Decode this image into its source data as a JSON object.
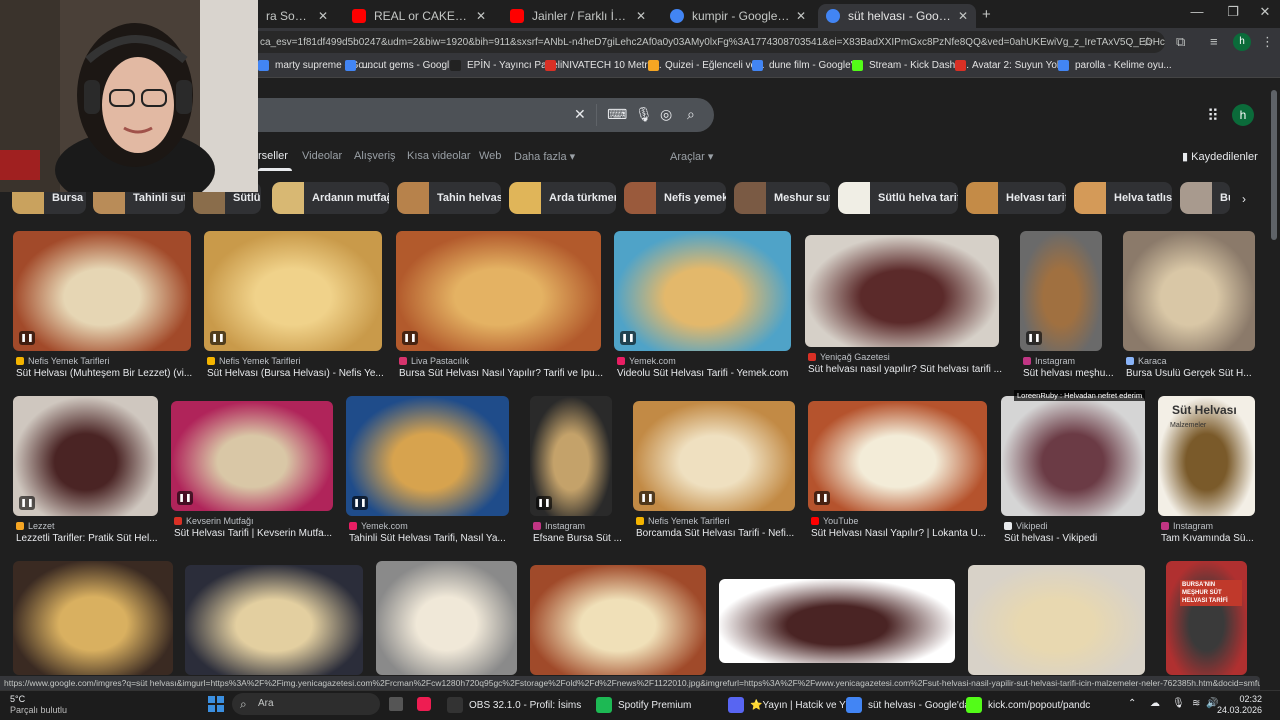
{
  "browser": {
    "tabs": [
      {
        "title": "ra Sokak Ye",
        "favicon_color": "#ff0000"
      },
      {
        "title": "REAL or CAKE Quiz? ✔️🍰❌",
        "favicon_color": "#ff0000"
      },
      {
        "title": "Jainler / Farklı İnançlar - YouTube",
        "favicon_color": "#ff0000"
      },
      {
        "title": "kumpir - Google'da Ara",
        "favicon_color": "#4285f4"
      },
      {
        "title": "süt helvası - Google'da Ara",
        "favicon_color": "#4285f4"
      }
    ],
    "new_tab": "+",
    "url": "ca_esv=1f81df499d5b0247&udm=2&biw=1920&bih=911&sxsrf=ANbL-n4heD7giLehc2Af0a0y03AMy0lxFg%3A1774308703541&ei=X83BadXXIPmGxc8PzNfe8QQ&ved=0ahUKEwiVg_z_IreTAxV5Q_EDHcyrN04Q4...",
    "profile_initial": "h",
    "bookmarks": [
      {
        "label": "marty supreme - Go...",
        "color": "#4285f4"
      },
      {
        "label": "uncut gems - Googl...",
        "color": "#4285f4"
      },
      {
        "label": "EPİN - Yayıncı Paneli",
        "color": "#222222"
      },
      {
        "label": "NIVATECH 10 Metre...",
        "color": "#d93025"
      },
      {
        "label": "Quizei - Eğlenceli ve...",
        "color": "#f6a623"
      },
      {
        "label": "dune film - Google'...",
        "color": "#4285f4"
      },
      {
        "label": "Stream - Kick Dashb...",
        "color": "#53fc18"
      },
      {
        "label": "Avatar 2: Suyun Yol...",
        "color": "#d93025"
      },
      {
        "label": "parolla - Kelime oyu...",
        "color": "#4285f4"
      }
    ]
  },
  "google": {
    "nav": [
      "rseller",
      "Videolar",
      "Alışveriş",
      "Kısa videolar",
      "Web",
      "Daha fazla"
    ],
    "tools": "Araçlar",
    "saved": "Kaydedilenler",
    "profile_initial": "h",
    "chips": [
      {
        "label": "Bursa",
        "color": "#c9a25e"
      },
      {
        "label": "Tahinli sut",
        "color": "#b98c58"
      },
      {
        "label": "Sütlü",
        "color": "#8a6d4b"
      },
      {
        "label": "Ardanın mutfağı",
        "color": "#d8b873"
      },
      {
        "label": "Tahin helvası",
        "color": "#b7824b"
      },
      {
        "label": "Arda türkmen",
        "color": "#e0b559"
      },
      {
        "label": "Nefis yemek",
        "color": "#9a5a3c"
      },
      {
        "label": "Meshur sut",
        "color": "#7a5a44"
      },
      {
        "label": "Sütlü helva tarifi",
        "color": "#f0eee5"
      },
      {
        "label": "Helvası tarif",
        "color": "#c48b47"
      },
      {
        "label": "Helva tatlısı",
        "color": "#d49a58"
      },
      {
        "label": "Bur",
        "color": "#a89a8e"
      }
    ],
    "results": [
      {
        "source": "Nefis Yemek Tarifleri",
        "title": "Süt Helvası (Muhteşem Bir Lezzet) (vi...",
        "fav": "#f4b400",
        "c1": "#a24a2a",
        "c2": "#e6d6b4",
        "badge": true
      },
      {
        "source": "Nefis Yemek Tarifleri",
        "title": "Süt Helvası (Bursa Helvası) - Nefis Ye...",
        "fav": "#f4b400",
        "c1": "#c99a4a",
        "c2": "#f0d28a",
        "badge": true
      },
      {
        "source": "Liva Pastacılık",
        "title": "Bursa Süt Helvası Nasıl Yapılır? Tarifi ve İpu...",
        "fav": "#d6336c",
        "c1": "#b25a2c",
        "c2": "#e4b263",
        "badge": true
      },
      {
        "source": "Yemek.com",
        "title": "Videolu Süt Helvası Tarifi - Yemek.com",
        "fav": "#e91e63",
        "c1": "#4fa3c8",
        "c2": "#e3b86b",
        "badge": true
      },
      {
        "source": "Yeniçağ Gazetesi",
        "title": "Süt helvası nasıl yapılır? Süt helvası tarifi ...",
        "fav": "#d93025",
        "c1": "#d6d0c8",
        "c2": "#5b2a2a",
        "badge": false
      },
      {
        "source": "Instagram",
        "title": "Süt helvası meşhu...",
        "fav": "#c13584",
        "c1": "#6a6a6a",
        "c2": "#a07040",
        "badge": true
      },
      {
        "source": "Karaca",
        "title": "Bursa Usulü Gerçek Süt H...",
        "fav": "#8ab4f8",
        "c1": "#8b7a6a",
        "c2": "#d9c7a6",
        "badge": false
      },
      {
        "source": "Lezzet",
        "title": "Lezzetli Tarifler: Pratik Süt Hel...",
        "fav": "#f6a623",
        "c1": "#cfc7bf",
        "c2": "#4a2424",
        "badge": true
      },
      {
        "source": "Kevserin Mutfağı",
        "title": "Süt Helvası Tarifi | Kevserin Mutfa...",
        "fav": "#d93025",
        "c1": "#b0245a",
        "c2": "#d9c7a6",
        "badge": true
      },
      {
        "source": "Yemek.com",
        "title": "Tahinli Süt Helvası Tarifi, Nasıl Ya...",
        "fav": "#e91e63",
        "c1": "#1f4c8a",
        "c2": "#d7a34e",
        "badge": true
      },
      {
        "source": "Instagram",
        "title": "Efsane Bursa Süt ...",
        "fav": "#c13584",
        "c1": "#2a2a2a",
        "c2": "#c4a26a",
        "badge": true
      },
      {
        "source": "Nefis Yemek Tarifleri",
        "title": "Borcamda Süt Helvası Tarifi - Nefi...",
        "fav": "#f4b400",
        "c1": "#c28a45",
        "c2": "#efe0c0",
        "badge": true
      },
      {
        "source": "YouTube",
        "title": "Süt Helvası Nasıl Yapılır? | Lokanta U...",
        "fav": "#ff0000",
        "c1": "#b5532d",
        "c2": "#f3ecd8",
        "badge": true
      },
      {
        "source": "Vikipedi",
        "title": "Süt helvası - Vikipedi",
        "fav": "#e8eaed",
        "c1": "#d5d5d5",
        "c2": "#6b3b45",
        "badge": false
      },
      {
        "source": "Instagram",
        "title": "Tam Kıvamında Sü...",
        "fav": "#c13584",
        "c1": "#f3efe6",
        "c2": "#7a5a2a",
        "badge": false
      }
    ],
    "row1_overlay": "LoreenRuby : Helvadan nefret ederim",
    "row2_card_text": "Süt Helvası",
    "row2_card_sub": "Malzemeler",
    "row3_badge_text": "BURSA'NIN MEŞHUR SÜT HELVASI TARİFİ"
  },
  "status_url": "https://www.google.com/imgres?q=süt helvası&imgurl=https%3A%2F%2Fimg.yenicagazetesi.com%2Frcman%2Fcw1280h720q95gc%2Fstorage%2Fold%2Fd%2Fnews%2F1122010.jpg&imgrefurl=https%3A%2F%2Fwww.yenicagazetesi.com%2Fsut-helvasi-nasil-yapilir-sut-helvasi-tarifi-icin-malzemeler-neler-762385h.htm&docid=smfu0gj9c6gmM&tbni...",
  "taskbar": {
    "weather_temp": "5°C",
    "weather_desc": "Parçalı bulutlu",
    "search": "Ara",
    "apps": [
      {
        "label": "OBS 32.1.0 - Profil: İsims",
        "color": "#333"
      },
      {
        "label": "Spotify Premium",
        "color": "#1db954"
      },
      {
        "label": "⭐Yayın | Hatcik ve Yc",
        "color": "#5865f2"
      },
      {
        "label": "süt helvası - Google'da",
        "color": "#4285f4"
      },
      {
        "label": "kick.com/popout/pandc",
        "color": "#53fc18"
      }
    ],
    "time": "02:32",
    "date": "24.03.2026"
  }
}
